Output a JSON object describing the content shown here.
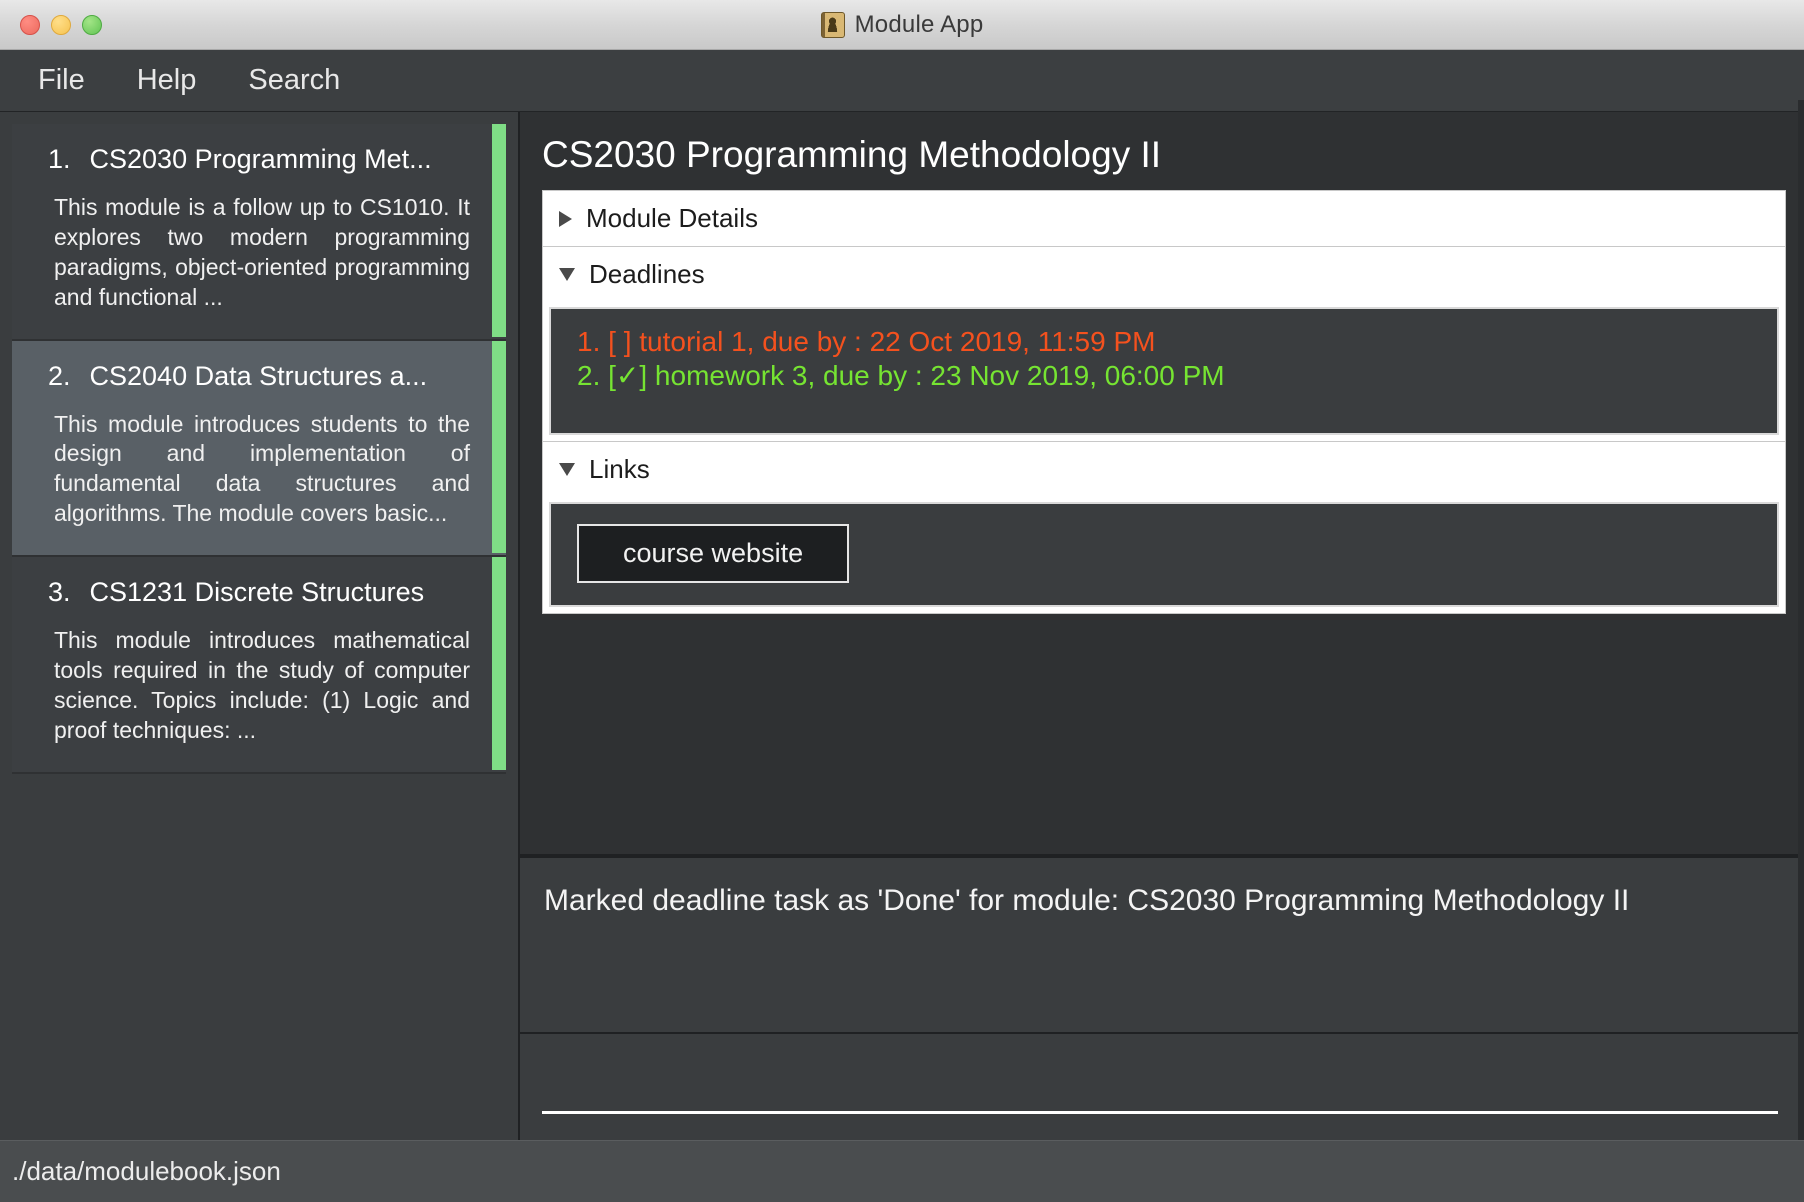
{
  "window": {
    "title": "Module App",
    "icon": "address-book-icon",
    "traffic_lights": [
      "close",
      "minimize",
      "zoom"
    ]
  },
  "menubar": {
    "items": [
      {
        "label": "File"
      },
      {
        "label": "Help"
      },
      {
        "label": "Search"
      }
    ]
  },
  "sidebar": {
    "modules": [
      {
        "index": "1.",
        "title": "CS2030 Programming Met...",
        "description": "This module is a follow up to CS1010. It explores two modern programming paradigms, object-oriented programming and functional ...",
        "selected": false,
        "accent_color": "#7fdd86"
      },
      {
        "index": "2.",
        "title": "CS2040 Data Structures a...",
        "description": "This module introduces students to the design and implementation of fundamental data structures and algorithms. The module covers basic...",
        "selected": true,
        "accent_color": "#7fdd86"
      },
      {
        "index": "3.",
        "title": "CS1231 Discrete Structures",
        "description": "This module introduces mathematical tools required in the study of computer science. Topics include: (1) Logic and proof techniques: ...",
        "selected": false,
        "accent_color": "#7fdd86"
      }
    ]
  },
  "detail": {
    "heading": "CS2030 Programming Methodology II",
    "panes": [
      {
        "key": "module_details",
        "title": "Module Details",
        "expanded": false,
        "arrow": "triangle-right-icon"
      },
      {
        "key": "deadlines",
        "title": "Deadlines",
        "expanded": true,
        "arrow": "triangle-down-icon"
      },
      {
        "key": "links",
        "title": "Links",
        "expanded": true,
        "arrow": "triangle-down-icon"
      }
    ],
    "deadlines": [
      {
        "text": "1. [ ] tutorial 1, due by : 22 Oct 2019, 11:59 PM",
        "status": "overdue",
        "color": "#f4511e"
      },
      {
        "text": "2. [✓] homework 3, due by : 23 Nov 2019, 06:00 PM",
        "status": "done",
        "color": "#76e432"
      }
    ],
    "links": [
      {
        "label": "course website"
      }
    ]
  },
  "result": {
    "message": "Marked deadline task as 'Done' for module: CS2030 Programming Methodology II"
  },
  "command": {
    "value": "",
    "placeholder": ""
  },
  "statusbar": {
    "file_path": "./data/modulebook.json"
  }
}
